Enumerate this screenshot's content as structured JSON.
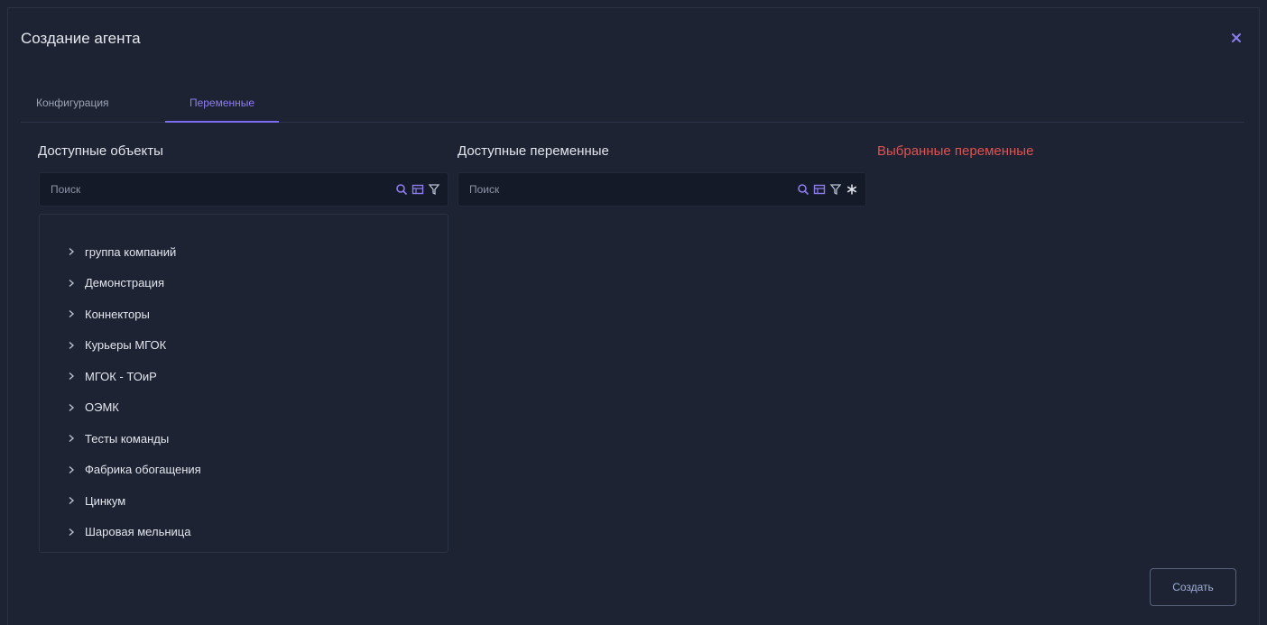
{
  "dialog": {
    "title": "Создание агента",
    "close_icon": "close-icon"
  },
  "tabs": [
    {
      "label": "Конфигурация",
      "active": false
    },
    {
      "label": "Переменные",
      "active": true
    }
  ],
  "columns": {
    "objects": {
      "heading": "Доступные объекты",
      "search_placeholder": "Поиск",
      "icons": [
        "search-icon",
        "table-icon",
        "filter-icon"
      ],
      "tree": [
        "группа компаний",
        "Демонстрация",
        "Коннекторы",
        "Курьеры МГОК",
        "МГОК - ТОиР",
        "ОЭМК",
        "Тесты команды",
        "Фабрика обогащения",
        "Цинкум",
        "Шаровая мельница"
      ]
    },
    "variables": {
      "heading": "Доступные переменные",
      "search_placeholder": "Поиск",
      "icons": [
        "search-icon",
        "table-icon",
        "filter-icon",
        "asterisk-icon"
      ]
    },
    "selected": {
      "heading": "Выбранные переменные"
    }
  },
  "footer": {
    "create_label": "Создать"
  },
  "colors": {
    "background": "#1d2333",
    "accent": "#7b6cf0",
    "danger_heading": "#e0524f",
    "input_bg": "#141a27"
  }
}
